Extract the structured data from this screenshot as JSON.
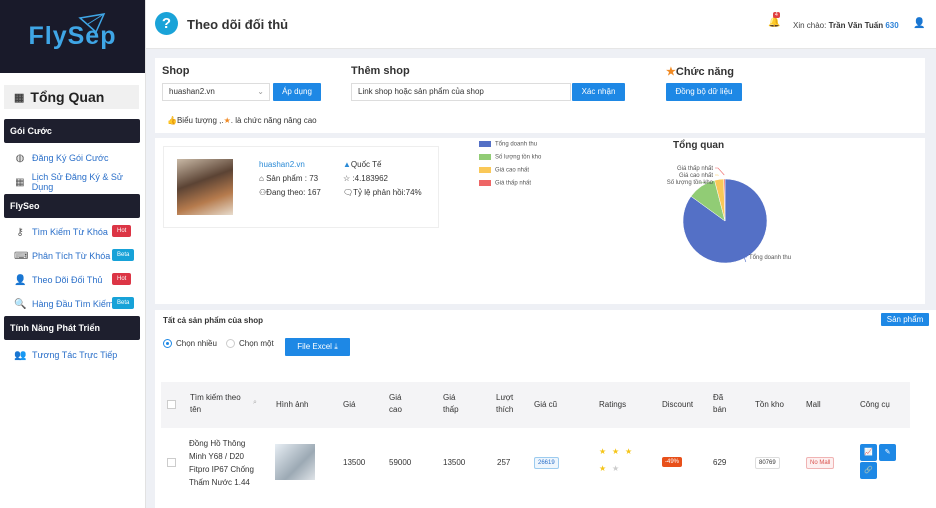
{
  "sidebar": {
    "logo": "FlySep",
    "overview": "Tổng Quan",
    "sections": [
      {
        "title": "Gói Cước",
        "items": [
          {
            "label": "Đăng Ký Gói Cước",
            "icon": "globe-icon"
          },
          {
            "label": "Lịch Sử Đăng Ký & Sử Dụng",
            "icon": "grid-icon"
          }
        ]
      },
      {
        "title": "FlySeo",
        "items": [
          {
            "label": "Tìm Kiếm Từ Khóa",
            "icon": "key-icon",
            "badge": "Hot"
          },
          {
            "label": "Phân Tích Từ Khóa",
            "icon": "keyboard-icon",
            "badge": "Beta"
          },
          {
            "label": "Theo Dõi Đối Thủ",
            "icon": "user-plus-icon",
            "badge": "Hot"
          },
          {
            "label": "Hàng Đầu Tìm Kiếm",
            "icon": "search-icon",
            "badge": "Beta"
          }
        ]
      },
      {
        "title": "Tính Năng Phát Triển",
        "items": [
          {
            "label": "Tương Tác Trực Tiếp",
            "icon": "users-icon"
          }
        ]
      }
    ]
  },
  "header": {
    "title": "Theo dõi đối thủ",
    "notif_count": "4",
    "greeting": "Xin chào:",
    "user_name": "Trần Văn Tuấn",
    "points": "630"
  },
  "controls": {
    "shop_label": "Shop",
    "shop_value": "huashan2.vn",
    "apply": "Áp dụng",
    "add_shop_label": "Thêm shop",
    "add_shop_placeholder": "Link shop hoặc sản phẩm của shop",
    "confirm": "Xác nhận",
    "func_label": "Chức năng",
    "sync": "Đồng bộ dữ liệu",
    "note_before": "Biểu tượng ,.",
    "note_after": ". là chức năng nâng cao"
  },
  "shop": {
    "name": "huashan2.vn",
    "products": "Sản phẩm : 73",
    "following": "Đang theo: 167",
    "region": "Quốc Tế",
    "rating": ":4.183962",
    "response": "Tỷ lệ phản hồi:74%"
  },
  "chart_data": {
    "type": "pie",
    "title": "Tổng quan",
    "categories": [
      "Tổng doanh thu",
      "Số lượng tồn kho",
      "Giá cao nhất",
      "Giá thấp nhất"
    ],
    "values": [
      85,
      11,
      3.5,
      0.5
    ],
    "colors": [
      "#5470c6",
      "#91cc75",
      "#fac858",
      "#ee6666"
    ],
    "legend": "top-left"
  },
  "products": {
    "title": "Tất cả sản phẩm của shop",
    "tab": "Sản phẩm",
    "radio_multi": "Chọn nhiều",
    "radio_single": "Chọn một",
    "excel": "File Excel",
    "columns": {
      "search": "Tìm kiếm theo tên",
      "image": "Hình ảnh",
      "price": "Giá",
      "high": "Giá cao",
      "low": "Giá thấp",
      "views": "Lượt thích",
      "old": "Giá cũ",
      "ratings": "Ratings",
      "discount": "Discount",
      "sold": "Đã bán",
      "stock": "Tồn kho",
      "mall": "Mall",
      "tools": "Công cụ"
    },
    "rows": [
      {
        "name": "Đồng Hồ Thông Minh Y68 / D20 Fitpro IP67 Chống Thấm Nước 1.44",
        "price": "13500",
        "high": "59000",
        "low": "13500",
        "likes": "257",
        "old": "26619",
        "rating": 3,
        "discount": "-49%",
        "sold": "629",
        "stock": "80769",
        "mall": "No Mall"
      }
    ]
  }
}
